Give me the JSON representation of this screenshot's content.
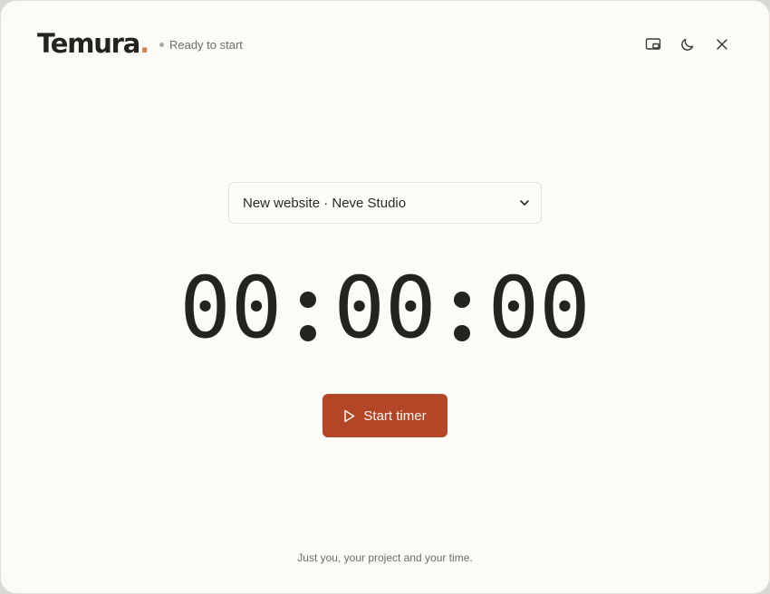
{
  "app": {
    "logo_text": "Temura",
    "logo_dot": ".",
    "status": "Ready to start"
  },
  "controls": [
    {
      "name": "picture-in-picture-button",
      "icon": "picture-in-picture-icon"
    },
    {
      "name": "dark-mode-button",
      "icon": "moon-icon"
    },
    {
      "name": "close-button",
      "icon": "close-icon"
    }
  ],
  "project_select": {
    "selected": "New website · Neve Studio"
  },
  "timer": {
    "hours": "00",
    "minutes": "00",
    "seconds": "00"
  },
  "start_button": {
    "label": "Start timer",
    "icon": "play-icon"
  },
  "footer": {
    "tagline": "Just you, your project and your time."
  },
  "colors": {
    "background": "#fcfbf7",
    "accent": "#b24626",
    "logo_dot": "#d4834f",
    "text": "#24231f"
  }
}
